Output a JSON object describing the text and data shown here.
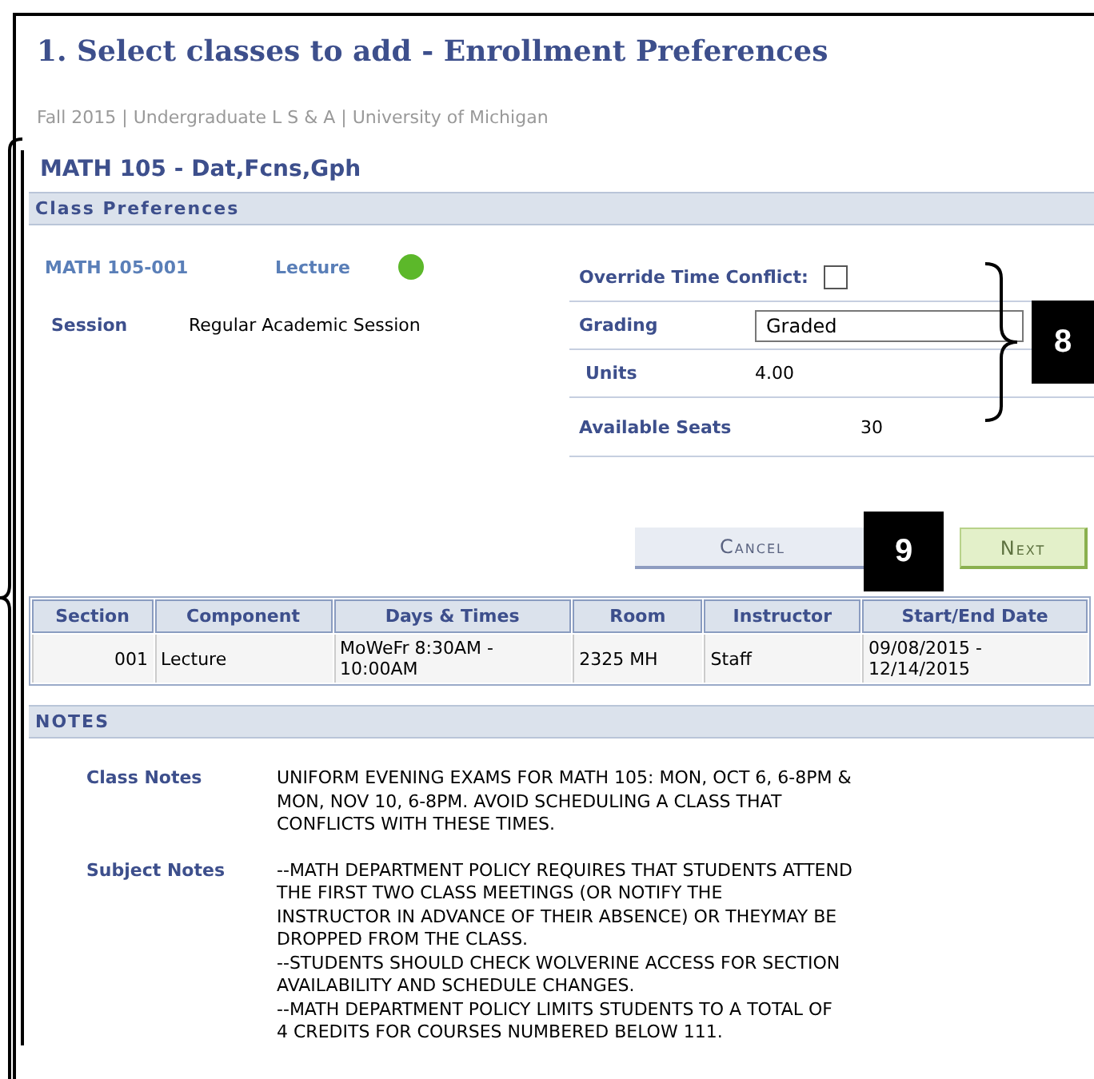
{
  "title": "1.  Select classes to add - Enrollment Preferences",
  "context": "Fall 2015 | Undergraduate L S & A | University of Michigan",
  "course_heading": "MATH  105 - Dat,Fcns,Gph",
  "preferences": {
    "header": "Class Preferences",
    "class_link": "MATH  105-001",
    "component_link": "Lecture",
    "section_open": true,
    "session_label": "Session",
    "session_value": "Regular Academic Session",
    "override": {
      "label": "Override Time Conflict:",
      "checked": false
    },
    "grading": {
      "label": "Grading",
      "value": "Graded"
    },
    "units": {
      "label": "Units",
      "value": "4.00"
    },
    "seats": {
      "label": "Available Seats",
      "value": "30"
    }
  },
  "buttons": [
    {
      "label": "Cancel",
      "kind": "cancel"
    },
    {
      "label": "Next",
      "kind": "next"
    }
  ],
  "callouts": [
    "8",
    "9"
  ],
  "table": {
    "columns": [
      "Section",
      "Component",
      "Days & Times",
      "Room",
      "Instructor",
      "Start/End Date"
    ],
    "rows": [
      [
        "001",
        "Lecture",
        "MoWeFr 8:30AM -\n10:00AM",
        "2325 MH",
        "Staff",
        "09/08/2015 -\n12/14/2015"
      ]
    ]
  },
  "notes": {
    "header": "NOTES",
    "items": [
      {
        "label": "Class Notes",
        "text": "UNIFORM EVENING EXAMS FOR MATH 105: MON, OCT 6, 6-8PM &\nMON, NOV 10, 6-8PM.  AVOID SCHEDULING A CLASS THAT\nCONFLICTS WITH THESE TIMES."
      },
      {
        "label": "Subject Notes",
        "text": "--MATH DEPARTMENT POLICY REQUIRES THAT STUDENTS ATTEND\nTHE FIRST TWO CLASS MEETINGS (OR NOTIFY THE\nINSTRUCTOR IN ADVANCE OF THEIR ABSENCE) OR THEYMAY BE\nDROPPED FROM THE CLASS.\n--STUDENTS SHOULD CHECK WOLVERINE ACCESS FOR SECTION\nAVAILABILITY AND SCHEDULE CHANGES.\n--MATH DEPARTMENT POLICY LIMITS STUDENTS TO A TOTAL OF\n4 CREDITS FOR COURSES NUMBERED BELOW 111."
      }
    ]
  }
}
